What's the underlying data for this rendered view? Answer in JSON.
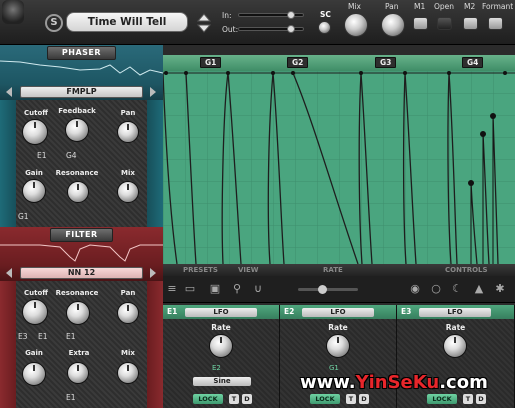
{
  "header": {
    "preset_name": "Time Will Tell",
    "s_label": "S",
    "in_label": "In:",
    "out_label": "Out:",
    "sc_label": "SC",
    "mix_label": "Mix",
    "pan_label": "Pan",
    "m1_label": "M1",
    "open_label": "Open",
    "m2_label": "M2",
    "formant_label": "Formant",
    "in_level": 0.75,
    "out_level": 0.75
  },
  "phaser": {
    "title": "PHASER",
    "mode": "FMPLP",
    "knobs": {
      "cutoff": "Cutoff",
      "feedback": "Feedback",
      "pan": "Pan",
      "gain": "Gain",
      "resonance": "Resonance",
      "mix": "Mix"
    },
    "mod_cutoff": "E1",
    "mod_feedback": "G4",
    "mod_gain": "G1"
  },
  "filter": {
    "title": "FILTER",
    "mode": "NN 12",
    "knobs": {
      "cutoff": "Cutoff",
      "resonance": "Resonance",
      "pan": "Pan",
      "gain": "Gain",
      "extra": "Extra",
      "mix": "Mix"
    },
    "mod_cutoff_a": "E3",
    "mod_cutoff_b": "E1",
    "mod_resonance": "E1",
    "mod_extra": "E1"
  },
  "sequencer": {
    "groups": [
      "G1",
      "G2",
      "G3",
      "G4"
    ],
    "tabs": [
      "PRESETS",
      "VIEW",
      "RATE",
      "CONTROLS"
    ]
  },
  "envelopes": [
    {
      "id": "E1",
      "type": "LFO",
      "rate_label": "Rate",
      "mod": "E2",
      "wave": "Sine",
      "lock": "LOCK",
      "t": "T",
      "d": "D"
    },
    {
      "id": "E2",
      "type": "LFO",
      "rate_label": "Rate",
      "mod": "G1",
      "wave": "",
      "lock": "LOCK",
      "t": "T",
      "d": "D"
    },
    {
      "id": "E3",
      "type": "LFO",
      "rate_label": "Rate",
      "mod": "",
      "wave": "",
      "lock": "LOCK",
      "t": "T",
      "d": "D"
    }
  ],
  "watermark": {
    "part1": "www.",
    "part2": "YinSeKu",
    "part3": ".com"
  }
}
